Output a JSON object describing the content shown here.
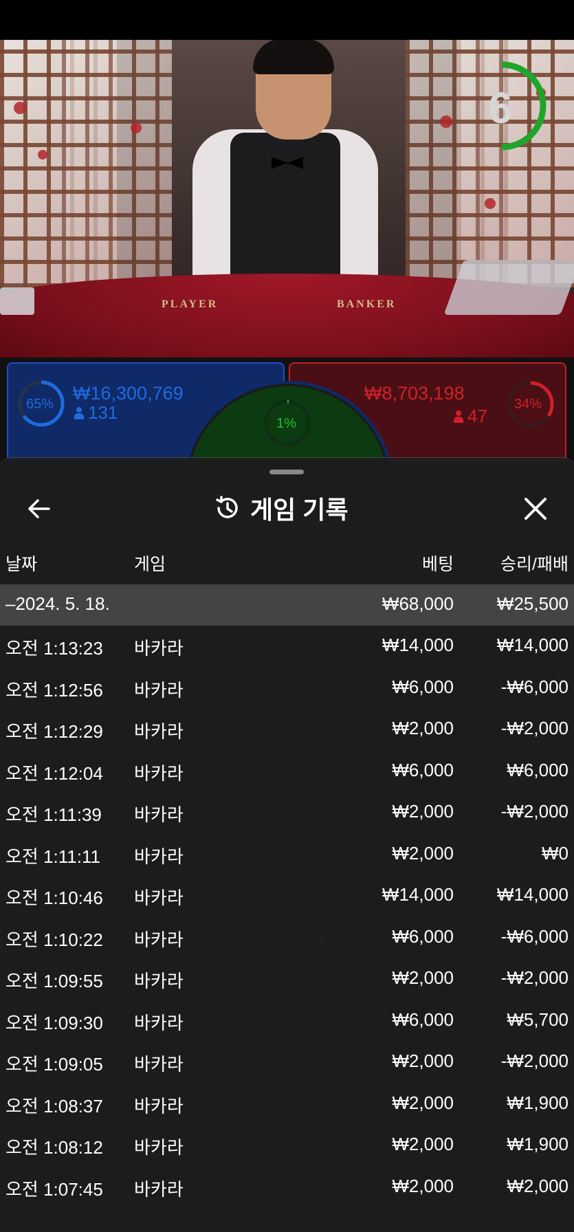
{
  "video": {
    "timer_value": "6",
    "felt_left": "PLAYER",
    "felt_right": "BANKER"
  },
  "bets": {
    "player": {
      "percent": "65%",
      "amount": "₩16,300,769",
      "players": "131",
      "color": "#1e6be0"
    },
    "tie": {
      "percent": "1%",
      "color": "#22c02a"
    },
    "banker": {
      "percent": "34%",
      "amount": "₩8,703,198",
      "players": "47",
      "color": "#d0202a"
    }
  },
  "sheet": {
    "title": "게임 기록",
    "icons": {
      "back": "arrow-left-icon",
      "history": "history-icon",
      "close": "close-icon"
    },
    "columns": {
      "date": "날짜",
      "game": "게임",
      "bet": "베팅",
      "result": "승리/패배"
    },
    "group": {
      "date": "–2024. 5. 18.",
      "bet": "₩68,000",
      "result": "₩25,500"
    },
    "rows": [
      {
        "time": "오전 1:13:23",
        "game": "바카라",
        "bet": "₩14,000",
        "result": "₩14,000"
      },
      {
        "time": "오전 1:12:56",
        "game": "바카라",
        "bet": "₩6,000",
        "result": "-₩6,000"
      },
      {
        "time": "오전 1:12:29",
        "game": "바카라",
        "bet": "₩2,000",
        "result": "-₩2,000"
      },
      {
        "time": "오전 1:12:04",
        "game": "바카라",
        "bet": "₩6,000",
        "result": "₩6,000"
      },
      {
        "time": "오전 1:11:39",
        "game": "바카라",
        "bet": "₩2,000",
        "result": "-₩2,000"
      },
      {
        "time": "오전 1:11:11",
        "game": "바카라",
        "bet": "₩2,000",
        "result": "₩0"
      },
      {
        "time": "오전 1:10:46",
        "game": "바카라",
        "bet": "₩14,000",
        "result": "₩14,000"
      },
      {
        "time": "오전 1:10:22",
        "game": "바카라",
        "bet": "₩6,000",
        "result": "-₩6,000"
      },
      {
        "time": "오전 1:09:55",
        "game": "바카라",
        "bet": "₩2,000",
        "result": "-₩2,000"
      },
      {
        "time": "오전 1:09:30",
        "game": "바카라",
        "bet": "₩6,000",
        "result": "₩5,700"
      },
      {
        "time": "오전 1:09:05",
        "game": "바카라",
        "bet": "₩2,000",
        "result": "-₩2,000"
      },
      {
        "time": "오전 1:08:37",
        "game": "바카라",
        "bet": "₩2,000",
        "result": "₩1,900"
      },
      {
        "time": "오전 1:08:12",
        "game": "바카라",
        "bet": "₩2,000",
        "result": "₩1,900"
      },
      {
        "time": "오전 1:07:45",
        "game": "바카라",
        "bet": "₩2,000",
        "result": "₩2,000"
      }
    ]
  }
}
